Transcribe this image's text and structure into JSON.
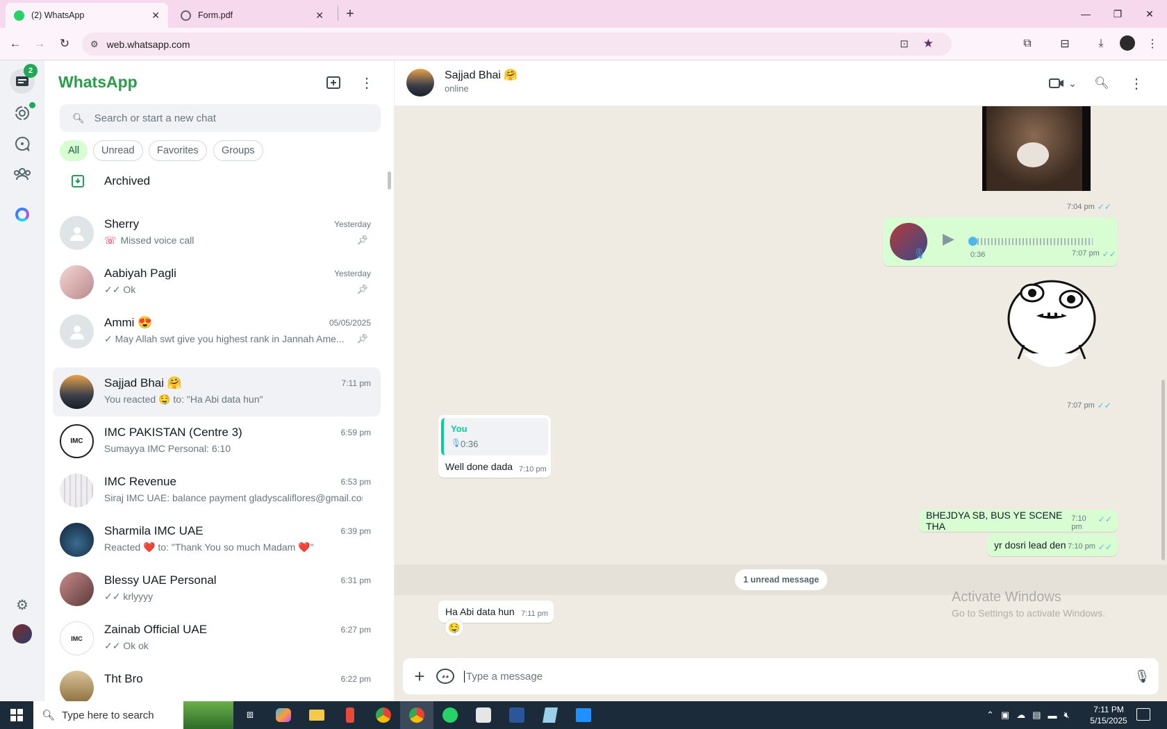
{
  "browser": {
    "tabs": [
      {
        "title": "(2) WhatsApp",
        "favicon": "whatsapp-icon",
        "active": true
      },
      {
        "title": "Form.pdf",
        "favicon": "globe-icon",
        "active": false
      }
    ],
    "url": "web.whatsapp.com"
  },
  "rail": {
    "chats_badge": "2"
  },
  "list": {
    "brand": "WhatsApp",
    "search_placeholder": "Search or start a new chat",
    "filters": [
      "All",
      "Unread",
      "Favorites",
      "Groups"
    ],
    "archived_label": "Archived",
    "chats": [
      {
        "name": "Sherry",
        "time": "Yesterday",
        "preview": "Missed voice call",
        "pinned": true
      },
      {
        "name": "Aabiyah Pagli",
        "time": "Yesterday",
        "preview": "✓✓ Ok",
        "pinned": true
      },
      {
        "name": "Ammi 😍",
        "time": "05/05/2025",
        "preview": "✓ May Allah swt give you highest rank in Jannah  Ame...",
        "pinned": true
      },
      {
        "name": "Sajjad Bhai 🤗",
        "time": "7:11 pm",
        "preview": "You reacted 🤤 to: \"Ha Abi data hun\"",
        "selected": true
      },
      {
        "name": "IMC PAKISTAN (Centre 3)",
        "time": "6:59 pm",
        "preview": "Sumayya IMC Personal: 6:10"
      },
      {
        "name": "IMC Revenue",
        "time": "6:53 pm",
        "preview": "Siraj IMC UAE: balance payment gladyscaliflores@gmail.com"
      },
      {
        "name": "Sharmila IMC UAE",
        "time": "6:39 pm",
        "preview": "Reacted ❤️ to: \"Thank You so much Madam ❤️\""
      },
      {
        "name": "Blessy UAE Personal",
        "time": "6:31 pm",
        "preview": "✓✓ krlyyyy"
      },
      {
        "name": "Zainab Official UAE",
        "time": "6:27 pm",
        "preview": "✓✓ Ok ok"
      },
      {
        "name": "Tht Bro",
        "time": "6:22 pm",
        "preview": ""
      }
    ]
  },
  "chat": {
    "name": "Sajjad Bhai 🤗",
    "status": "online",
    "messages": {
      "media_time": "7:04 pm",
      "voice_duration": "0:36",
      "voice_time": "7:07 pm",
      "sticker_time": "7:07 pm",
      "reply_author": "You",
      "reply_voice": "0:36",
      "reply_text": "Well done dada",
      "reply_time": "7:10 pm",
      "out1_text": "BHEJDYA SB, BUS YE SCENE THA",
      "out1_time": "7:10 pm",
      "out2_text": "yr dosri lead den",
      "out2_time": "7:10 pm",
      "unread_label": "1 unread message",
      "in_text": "Ha Abi data hun",
      "in_time": "7:11 pm",
      "in_reaction": "🤤"
    },
    "composer_placeholder": "Type a message"
  },
  "watermark": {
    "title": "Activate Windows",
    "subtitle": "Go to Settings to activate Windows."
  },
  "taskbar": {
    "search_placeholder": "Type here to search",
    "time": "7:11 PM",
    "date": "5/15/2025"
  },
  "colors": {
    "brand_green": "#25a047",
    "outgoing_bubble": "#d9fdd3",
    "chat_bg": "#efeae2",
    "read_tick": "#53bdeb",
    "tabbar": "#f7d9ee"
  }
}
